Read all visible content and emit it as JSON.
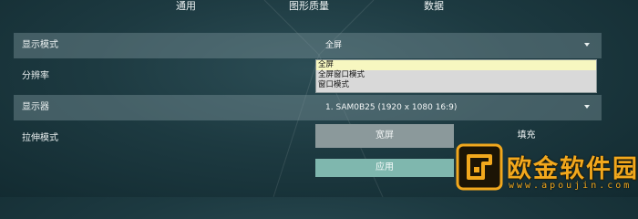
{
  "tabs": {
    "general": "通用",
    "graphics": "图形质量",
    "data": "数据"
  },
  "settings": {
    "display_mode": {
      "label": "显示模式",
      "value": "全屏",
      "icon": "chevron-down-icon"
    },
    "resolution": {
      "label": "分辨率"
    },
    "monitor": {
      "label": "显示器",
      "value": "1. SAM0B25 (1920 x  1080 16:9)",
      "icon": "chevron-down-icon"
    },
    "stretch_mode": {
      "label": "拉伸模式"
    }
  },
  "dropdown": {
    "options": [
      "全屏",
      "全屏窗口模式",
      "窗口模式"
    ],
    "selected": "全屏"
  },
  "buttons": {
    "widescreen": "宽屏",
    "fill": "填充",
    "apply": "应用"
  },
  "watermark": {
    "title": "欧金软件园",
    "url": "www.apoujin.com"
  },
  "colors": {
    "accent": "#7fb7ae",
    "watermark": "#f2a81d",
    "selected_option": "#f7f7c0"
  }
}
